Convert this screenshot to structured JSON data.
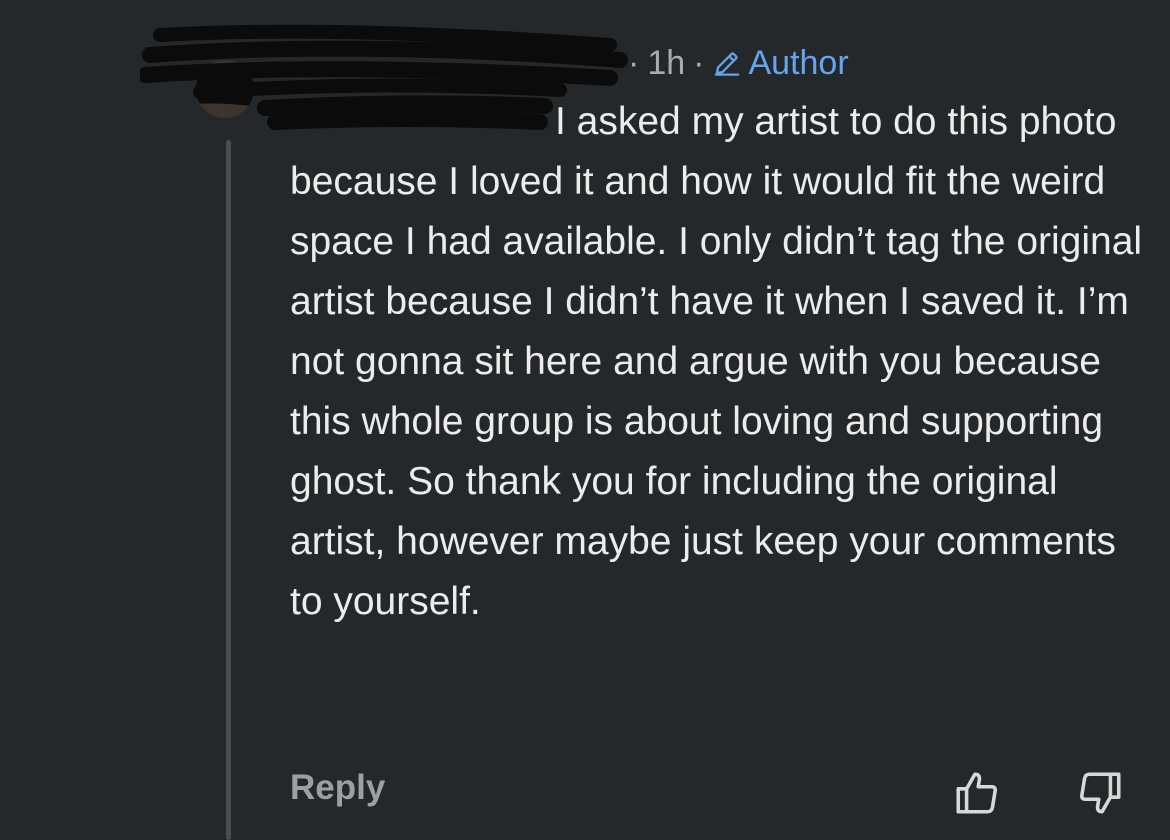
{
  "comment": {
    "time": "1h",
    "separator": "·",
    "author_badge": "Author",
    "body": "I asked my artist to do this photo because I loved it and how it would fit the weird space I had available. I only didn’t tag the original artist because I didn’t have it when I saved it. I’m not gonna sit here and argue with you because this whole group is about loving and supporting ghost. So thank you for including the original artist, however maybe just keep your comments to yourself.",
    "reply_label": "Reply"
  },
  "icons": {
    "author_badge": "pencil-icon",
    "upvote": "thumbs-up-icon",
    "downvote": "thumbs-down-icon"
  },
  "colors": {
    "background": "#25282a",
    "text": "#ececec",
    "meta": "#a9acaf",
    "accent": "#64a5f0",
    "redaction": "#0b0b0b"
  }
}
